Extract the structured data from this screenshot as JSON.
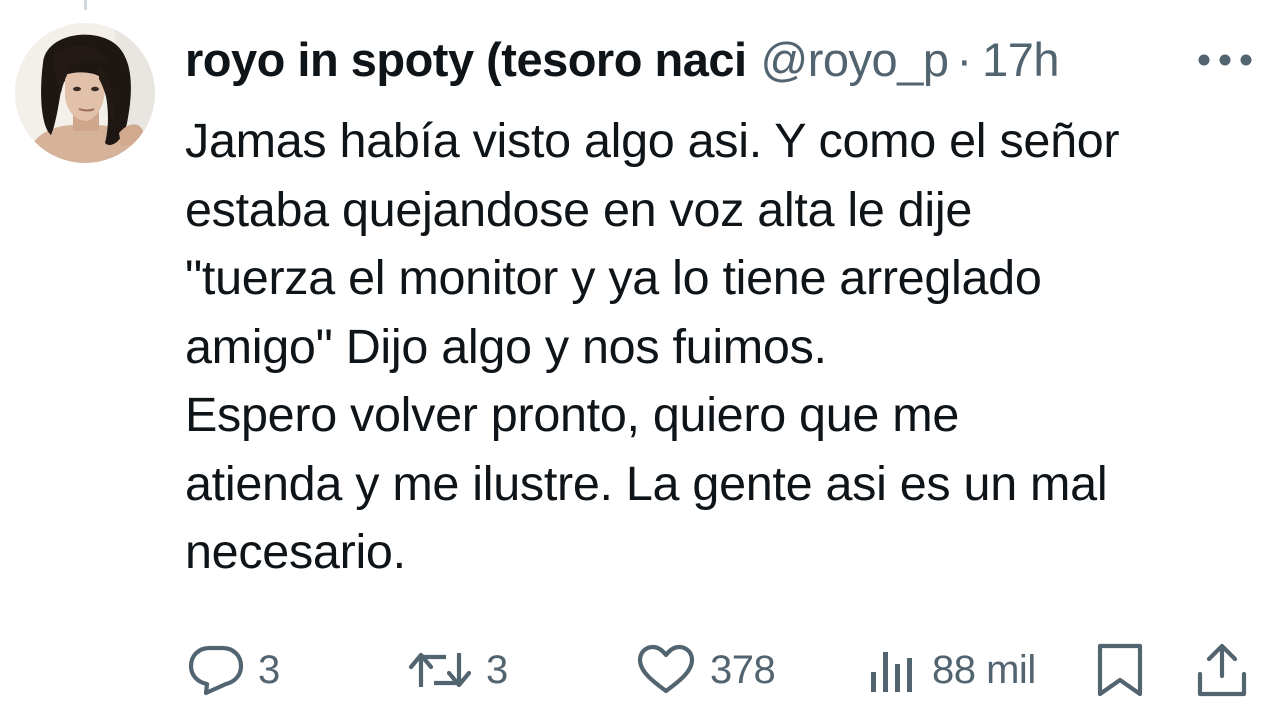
{
  "tweet": {
    "display_name": "royo in spoty (tesoro naci",
    "handle": "@royo_p",
    "separator": "·",
    "time": "17h",
    "text_lines": [
      "Jamas había visto algo asi. Y como el señor",
      "estaba quejandose en voz alta le dije",
      "\"tuerza el monitor y ya lo tiene arreglado",
      "amigo\" Dijo algo y nos fuimos.",
      "Espero volver pronto, quiero que me",
      "atienda y me ilustre. La gente asi es un mal",
      "necesario."
    ]
  },
  "actions": {
    "replies": "3",
    "reposts": "3",
    "likes": "378",
    "views": "88 mil"
  },
  "icons": {
    "more": "more-options-icon",
    "reply": "reply-icon",
    "repost": "repost-icon",
    "like": "heart-icon",
    "views": "views-icon",
    "bookmark": "bookmark-icon",
    "share": "share-icon"
  },
  "colors": {
    "text": "#0f1419",
    "secondary": "#536471",
    "thread_line": "#cfd9de"
  }
}
